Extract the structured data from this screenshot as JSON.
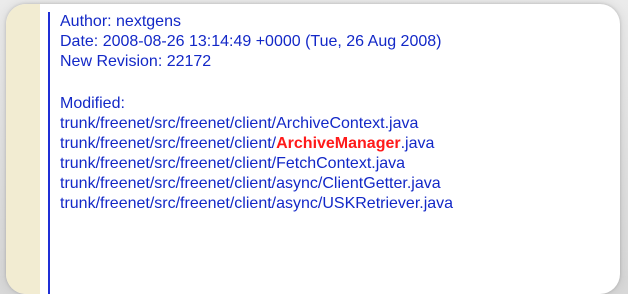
{
  "commit": {
    "author": "Author: nextgens",
    "date": "Date: 2008-08-26 13:14:49 +0000 (Tue, 26 Aug 2008)",
    "revision": "New Revision: 22172",
    "modified_label": "Modified:",
    "files": [
      {
        "path": "trunk/freenet/src/freenet/client/ArchiveContext.java"
      },
      {
        "prefix": "trunk/freenet/src/freenet/client/",
        "highlight": "ArchiveManager",
        "suffix": ".java"
      },
      {
        "path": "trunk/freenet/src/freenet/client/FetchContext.java"
      },
      {
        "path": "trunk/freenet/src/freenet/client/async/ClientGetter.java"
      },
      {
        "path": "trunk/freenet/src/freenet/client/async/USKRetriever.java"
      }
    ]
  },
  "colors": {
    "text": "#1328c7",
    "accent": "#ff1a1a",
    "rule": "#1f2fd6",
    "left_tint": "#f2ecd2"
  }
}
